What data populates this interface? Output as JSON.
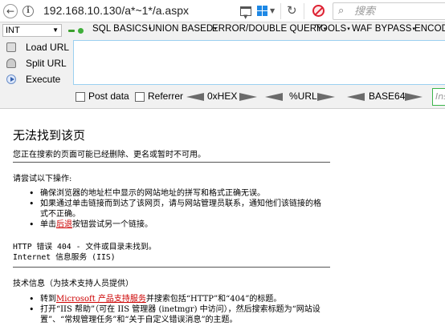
{
  "urlbar": {
    "url": "192.168.10.130/a*~1*/a.aspx",
    "search_placeholder": "搜索"
  },
  "hackbar": {
    "select_value": "INT",
    "menu": [
      "SQL BASICS",
      "UNION BASED",
      "ERROR/DOUBLE QUERY",
      "TOOLS",
      "WAF BYPASS",
      "ENCODI"
    ],
    "side": {
      "load": "Load URL",
      "split": "Split URL",
      "execute": "Execute"
    },
    "options": {
      "post": "Post data",
      "referrer": "Referrer",
      "hex": "0xHEX",
      "url": "%URL",
      "base64": "BASE64",
      "ins": "Ins"
    }
  },
  "page": {
    "title": "无法找到该页",
    "lead": "您正在搜索的页面可能已经删除、更名或暂时不可用。",
    "try_heading": "请尝试以下操作:",
    "try_items": [
      "确保浏览器的地址栏中显示的网站地址的拼写和格式正确无误。",
      "如果通过单击链接而到达了该网页，请与网站管理员联系，通知他们该链接的格式不正确。"
    ],
    "back_prefix": "单击",
    "back_link": "后退",
    "back_suffix": "按钮尝试另一个链接。",
    "error_line": "HTTP 错误 404 - 文件或目录未找到。",
    "server_line": "Internet 信息服务 (IIS)",
    "tech_heading": "技术信息（为技术支持人员提供）",
    "tech_item1_prefix": "转到",
    "tech_item1_link": "Microsoft 产品支持服务",
    "tech_item1_suffix": "并搜索包括“HTTP”和“404”的标题。",
    "tech_item2": "打开“IIS 帮助”（可在 IIS 管理器 (inetmgr) 中访问），然后搜索标题为“网站设置”、“常规管理任务”和“关于自定义错误消息”的主题。"
  }
}
